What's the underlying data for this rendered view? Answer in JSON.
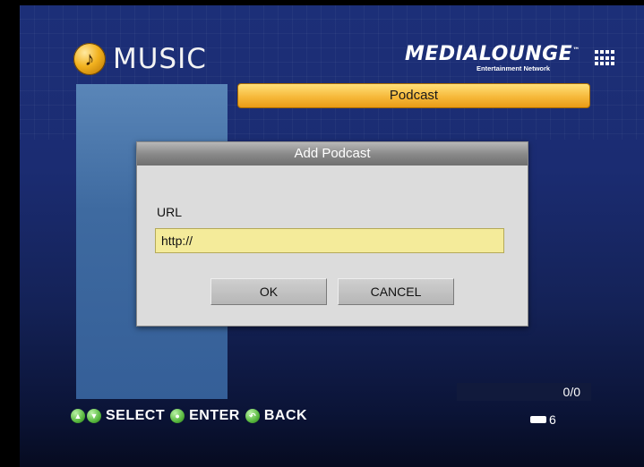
{
  "app": {
    "section_title": "MUSIC",
    "brand_name": "MEDIALOUNGE",
    "brand_trademark": "™",
    "brand_subtitle": "Entertainment Network"
  },
  "header": {
    "category": "Podcast"
  },
  "dialog": {
    "title": "Add Podcast",
    "url_label": "URL",
    "url_value": "http://",
    "ok_label": "OK",
    "cancel_label": "CANCEL"
  },
  "status": {
    "counter": "0/0",
    "battery_level": "6"
  },
  "footer": {
    "select_label": "SELECT",
    "enter_label": "ENTER",
    "back_label": "BACK"
  },
  "icons": {
    "logo": "music-note-icon",
    "nav": [
      "up-arrow-icon",
      "down-arrow-icon",
      "enter-icon",
      "back-icon",
      "battery-icon"
    ]
  },
  "colors": {
    "accent": "#f6b93b",
    "dialog_bg": "#dcdcdc",
    "input_bg": "#f4eb9a",
    "screen_bg": "#1b2c72"
  }
}
